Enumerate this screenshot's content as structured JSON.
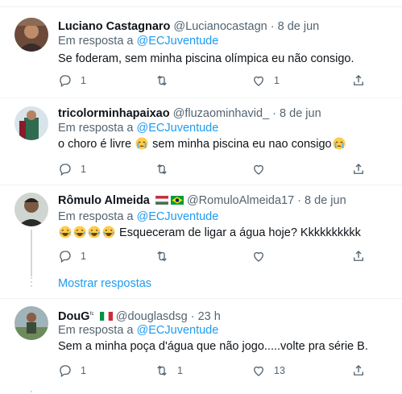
{
  "tweets": [
    {
      "name": "Luciano Castagnaro",
      "handle": "@Lucianocastagn",
      "separator": "·",
      "time": "8 de jun",
      "reply_prefix": "Em resposta a",
      "reply_to": "@ECJuventude",
      "text": "Se foderam, sem minha piscina olímpica eu não consigo.",
      "reply_count": "1",
      "retweet_count": "",
      "like_count": "1"
    },
    {
      "name": "tricolorminhapaixao",
      "handle": "@fluzaominhavid_",
      "separator": "·",
      "time": "8 de jun",
      "reply_prefix": "Em resposta a",
      "reply_to": "@ECJuventude",
      "text_a": "o choro é livre",
      "text_b": "sem minha piscina eu nao consigo",
      "reply_count": "1",
      "retweet_count": "",
      "like_count": ""
    },
    {
      "name": "Rômulo Almeida",
      "handle": "@RomuloAlmeida17",
      "separator": "·",
      "time": "8 de jun",
      "reply_prefix": "Em resposta a",
      "reply_to": "@ECJuventude",
      "text": "Esqueceram de ligar a água hoje? Kkkkkkkkkk",
      "reply_count": "1",
      "retweet_count": "",
      "like_count": ""
    },
    {
      "name": "DouG",
      "name_suffix": "ᶠᶜ",
      "handle": "@douglasdsg",
      "separator": "·",
      "time": "23 h",
      "reply_prefix": "Em resposta a",
      "reply_to": "@ECJuventude",
      "text": "Sem a minha poça d'água que não jogo.....volte pra série B.",
      "reply_count": "1",
      "retweet_count": "1",
      "like_count": "13"
    }
  ],
  "show_more_label": "Mostrar respostas",
  "colors": {
    "accent": "#1d9bf0",
    "secondary_text": "#536471",
    "divider": "#eff3f4"
  },
  "icons": [
    "reply-icon",
    "retweet-icon",
    "like-icon",
    "share-icon",
    "crying-emoji",
    "laughing-emoji",
    "hungary-flag",
    "brazil-flag",
    "italy-flag"
  ]
}
